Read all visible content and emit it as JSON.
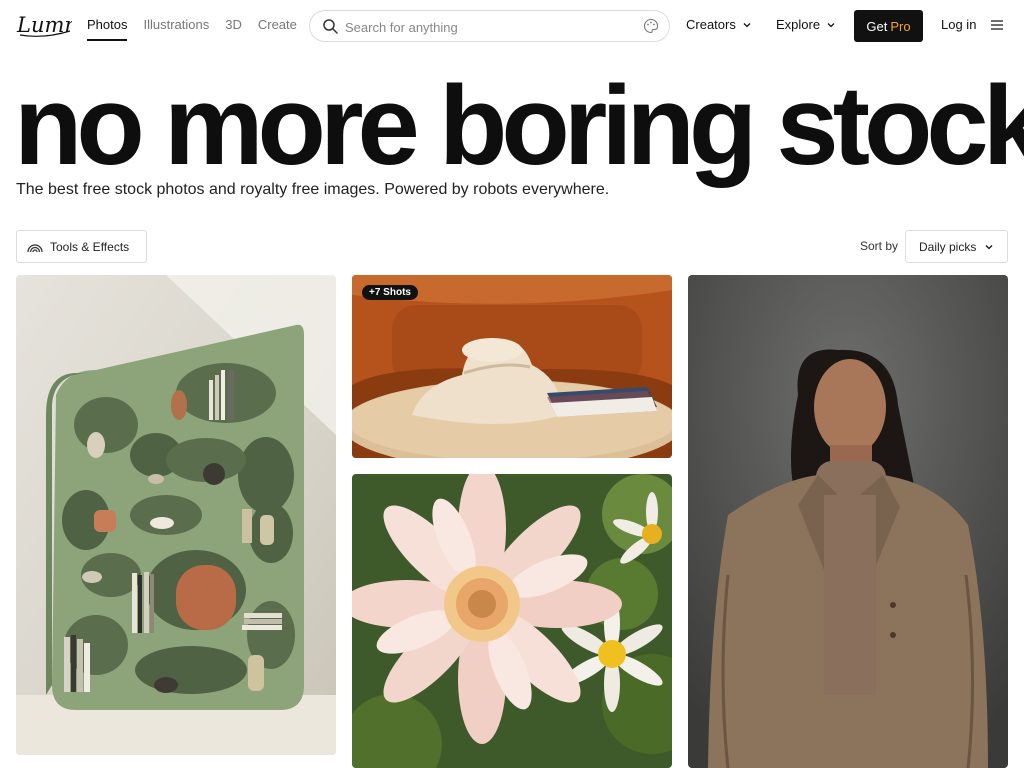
{
  "header": {
    "logo_text": "Lummi",
    "nav": [
      "Photos",
      "Illustrations",
      "3D",
      "Create"
    ],
    "active_nav": "Photos",
    "search_placeholder": "Search for anything",
    "creators_label": "Creators",
    "explore_label": "Explore",
    "getpro_prefix": "Get",
    "getpro_suffix": "Pro",
    "login_label": "Log in"
  },
  "hero": {
    "title": "no more boring stock",
    "subtitle": "The best free stock photos and royalty free images. Powered by robots everywhere."
  },
  "toolbar": {
    "tools_label": "Tools & Effects",
    "sort_by_label": "Sort by",
    "sort_value": "Daily picks"
  },
  "gallery": {
    "badge": "+7 Shots"
  },
  "colors": {
    "accent": "#f5a623",
    "dark": "#111111",
    "shelf_green": "#8da37a",
    "sofa_orange": "#b6521c"
  }
}
